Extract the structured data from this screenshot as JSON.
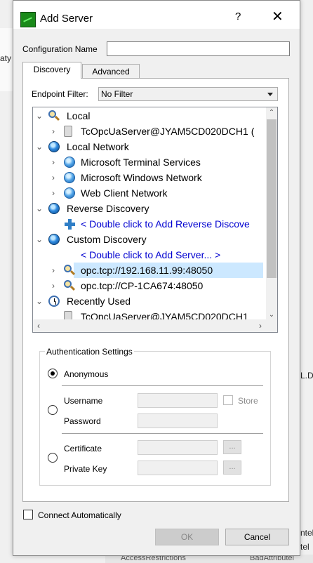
{
  "background_app": {
    "left_fragment": "aty",
    "right_fragment": "L.D",
    "bottom_left": "AccessRestrictions",
    "bottom_right": "BadAttributel",
    "right_edge_1": "ntel",
    "right_edge_2": "tel"
  },
  "dialog": {
    "title": "Add Server",
    "help_glyph": "?",
    "close_glyph": "✕",
    "configuration_name_label": "Configuration Name",
    "configuration_name_value": ""
  },
  "tabs": [
    {
      "label": "Discovery",
      "active": true
    },
    {
      "label": "Advanced",
      "active": false
    }
  ],
  "discovery": {
    "endpoint_filter_label": "Endpoint Filter:",
    "endpoint_filter_value": "No Filter",
    "tree": [
      {
        "label": "Local",
        "icon": "magnifier-icon",
        "expander": "⌄"
      },
      {
        "label": "TcOpcUaServer@JYAM5CD020DCH1 (",
        "icon": "server-icon",
        "expander": "›"
      },
      {
        "label": "Local Network",
        "icon": "globe-icon",
        "expander": "⌄"
      },
      {
        "label": "Microsoft Terminal Services",
        "icon": "network-globe-icon",
        "expander": "›"
      },
      {
        "label": "Microsoft Windows Network",
        "icon": "network-globe-icon",
        "expander": "›"
      },
      {
        "label": "Web Client Network",
        "icon": "network-globe-icon",
        "expander": "›"
      },
      {
        "label": "Reverse Discovery",
        "icon": "globe-icon",
        "expander": "⌄"
      },
      {
        "label": "< Double click to Add Reverse Discove",
        "icon": "add-icon",
        "expander": ""
      },
      {
        "label": "Custom Discovery",
        "icon": "globe-icon",
        "expander": "⌄"
      },
      {
        "label": "< Double click to Add Server... >",
        "icon": "",
        "expander": ""
      },
      {
        "label": "opc.tcp://192.168.11.99:48050",
        "icon": "magnifier-icon",
        "expander": "›"
      },
      {
        "label": "opc.tcp://CP-1CA674:48050",
        "icon": "magnifier-icon",
        "expander": "›"
      },
      {
        "label": "Recently Used",
        "icon": "clock-icon",
        "expander": "⌄"
      },
      {
        "label": "TcOpcUaServer@JYAM5CD020DCH1",
        "icon": "server-icon",
        "expander": ""
      }
    ]
  },
  "auth": {
    "legend": "Authentication Settings",
    "anonymous_label": "Anonymous",
    "username_label": "Username",
    "password_label": "Password",
    "store_label": "Store",
    "certificate_label": "Certificate",
    "private_key_label": "Private Key",
    "browse_glyph": "..."
  },
  "footer": {
    "connect_automatically_label": "Connect Automatically",
    "ok_label": "OK",
    "cancel_label": "Cancel"
  }
}
